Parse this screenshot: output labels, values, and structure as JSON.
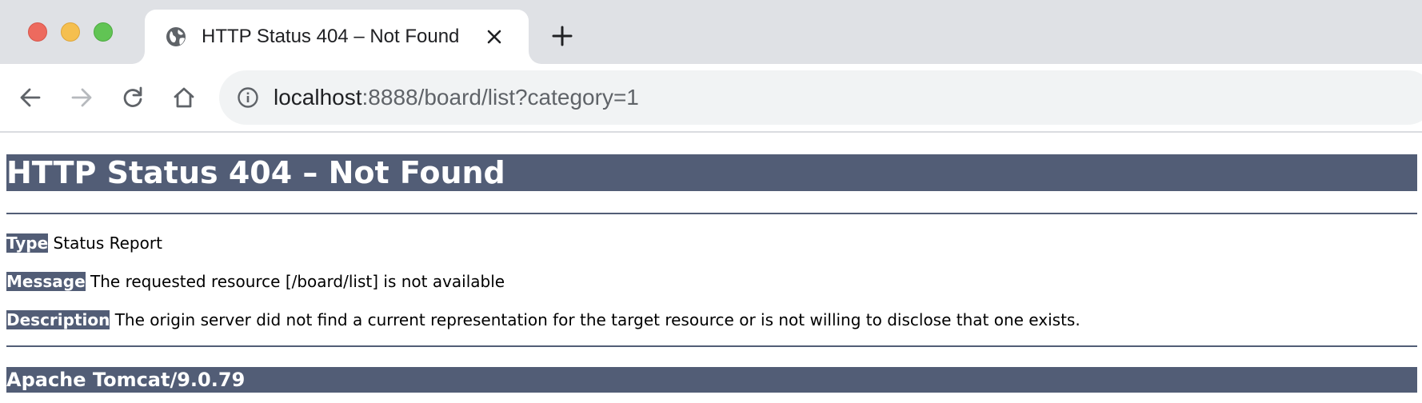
{
  "browser": {
    "window_controls": {
      "close_color": "#ed6a5e",
      "minimize_color": "#f5bf4f",
      "maximize_color": "#61c454"
    },
    "tab": {
      "title": "HTTP Status 404 – Not Found",
      "favicon": "globe-icon",
      "close_icon": "close-icon"
    },
    "new_tab_icon": "plus-icon",
    "toolbar": {
      "back_icon": "arrow-left-icon",
      "forward_icon": "arrow-right-icon",
      "reload_icon": "reload-icon",
      "home_icon": "home-icon"
    },
    "address_bar": {
      "info_icon": "info-icon",
      "url_host": "localhost",
      "url_rest": ":8888/board/list?category=1"
    }
  },
  "page": {
    "heading": "HTTP Status 404 – Not Found",
    "type_label": "Type",
    "type_value": " Status Report",
    "message_label": "Message",
    "message_value": " The requested resource [/board/list] is not available",
    "description_label": "Description",
    "description_value": " The origin server did not find a current representation for the target resource or is not willing to disclose that one exists.",
    "footer": "Apache Tomcat/9.0.79",
    "accent_color": "#525d76"
  }
}
